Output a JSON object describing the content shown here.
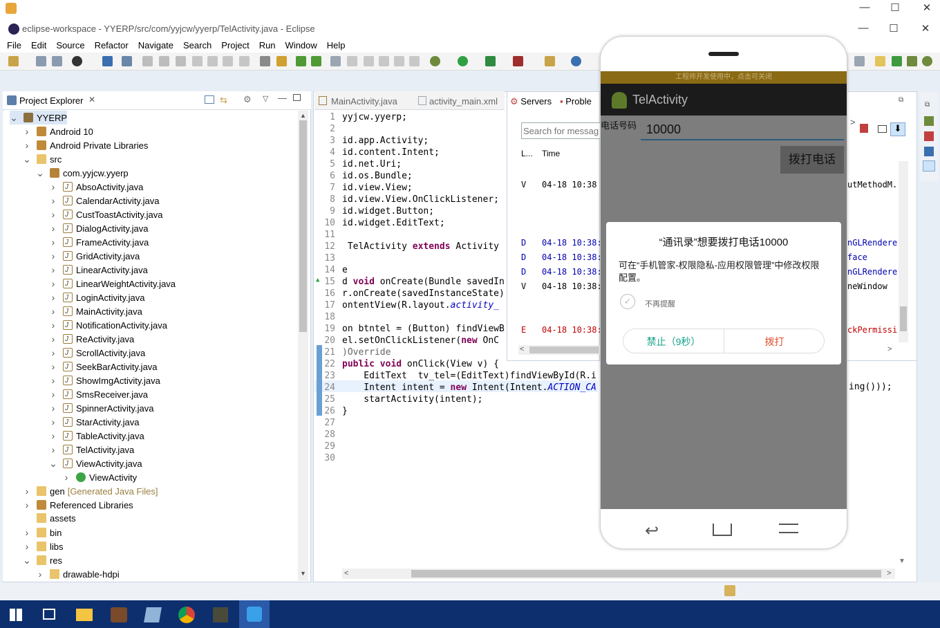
{
  "window": {
    "title": "eclipse-workspace - YYERP/src/com/yyjcw/yyerp/TelActivity.java - Eclipse"
  },
  "menu": [
    "File",
    "Edit",
    "Source",
    "Refactor",
    "Navigate",
    "Search",
    "Project",
    "Run",
    "Window",
    "Help"
  ],
  "project_explorer": {
    "tab_label": "Project Explorer",
    "items": [
      {
        "label": "YYERP",
        "level": 0,
        "twisty": "v",
        "icon": "proj"
      },
      {
        "label": "Android 10",
        "level": 1,
        "twisty": ">",
        "icon": "lib"
      },
      {
        "label": "Android Private Libraries",
        "level": 1,
        "twisty": ">",
        "icon": "lib"
      },
      {
        "label": "src",
        "level": 1,
        "twisty": "v",
        "icon": "folder"
      },
      {
        "label": "com.yyjcw.yyerp",
        "level": 2,
        "twisty": "v",
        "icon": "pkg"
      },
      {
        "label": "AbsoActivity.java",
        "level": 3,
        "twisty": ">",
        "icon": "java"
      },
      {
        "label": "CalendarActivity.java",
        "level": 3,
        "twisty": ">",
        "icon": "java"
      },
      {
        "label": "CustToastActivity.java",
        "level": 3,
        "twisty": ">",
        "icon": "java"
      },
      {
        "label": "DialogActivity.java",
        "level": 3,
        "twisty": ">",
        "icon": "java"
      },
      {
        "label": "FrameActivity.java",
        "level": 3,
        "twisty": ">",
        "icon": "java"
      },
      {
        "label": "GridActivity.java",
        "level": 3,
        "twisty": ">",
        "icon": "java"
      },
      {
        "label": "LinearActivity.java",
        "level": 3,
        "twisty": ">",
        "icon": "java"
      },
      {
        "label": "LinearWeightActivity.java",
        "level": 3,
        "twisty": ">",
        "icon": "java"
      },
      {
        "label": "LoginActivity.java",
        "level": 3,
        "twisty": ">",
        "icon": "java"
      },
      {
        "label": "MainActivity.java",
        "level": 3,
        "twisty": ">",
        "icon": "java"
      },
      {
        "label": "NotificationActivity.java",
        "level": 3,
        "twisty": ">",
        "icon": "java"
      },
      {
        "label": "ReActivity.java",
        "level": 3,
        "twisty": ">",
        "icon": "java"
      },
      {
        "label": "ScrollActivity.java",
        "level": 3,
        "twisty": ">",
        "icon": "java"
      },
      {
        "label": "SeekBarActivity.java",
        "level": 3,
        "twisty": ">",
        "icon": "java"
      },
      {
        "label": "ShowImgActivity.java",
        "level": 3,
        "twisty": ">",
        "icon": "java"
      },
      {
        "label": "SmsReceiver.java",
        "level": 3,
        "twisty": ">",
        "icon": "java"
      },
      {
        "label": "SpinnerActivity.java",
        "level": 3,
        "twisty": ">",
        "icon": "java"
      },
      {
        "label": "StarActivity.java",
        "level": 3,
        "twisty": ">",
        "icon": "java"
      },
      {
        "label": "TableActivity.java",
        "level": 3,
        "twisty": ">",
        "icon": "java"
      },
      {
        "label": "TelActivity.java",
        "level": 3,
        "twisty": ">",
        "icon": "java"
      },
      {
        "label": "ViewActivity.java",
        "level": 3,
        "twisty": "v",
        "icon": "java"
      },
      {
        "label": "ViewActivity",
        "level": 4,
        "twisty": ">",
        "icon": "class"
      },
      {
        "label": "gen",
        "level": 1,
        "twisty": ">",
        "icon": "folder",
        "suffix": "[Generated Java Files]"
      },
      {
        "label": "Referenced Libraries",
        "level": 1,
        "twisty": ">",
        "icon": "lib"
      },
      {
        "label": "assets",
        "level": 1,
        "twisty": "",
        "icon": "folder"
      },
      {
        "label": "bin",
        "level": 1,
        "twisty": ">",
        "icon": "folder"
      },
      {
        "label": "libs",
        "level": 1,
        "twisty": ">",
        "icon": "folder"
      },
      {
        "label": "res",
        "level": 1,
        "twisty": "v",
        "icon": "folder"
      },
      {
        "label": "drawable-hdpi",
        "level": 2,
        "twisty": ">",
        "icon": "folder"
      }
    ]
  },
  "editor": {
    "tabs": [
      "MainActivity.java",
      "activity_main.xml"
    ],
    "lines": [
      {
        "n": "1",
        "t": "yyjcw.yyerp;"
      },
      {
        "n": "2",
        "t": ""
      },
      {
        "n": "3",
        "t": "id.app.Activity;"
      },
      {
        "n": "4",
        "t": "id.content.Intent;"
      },
      {
        "n": "5",
        "t": "id.net.Uri;"
      },
      {
        "n": "6",
        "t": "id.os.Bundle;"
      },
      {
        "n": "7",
        "t": "id.view.View;"
      },
      {
        "n": "8",
        "t": "id.view.View.OnClickListener;"
      },
      {
        "n": "9",
        "t": "id.widget.Button;"
      },
      {
        "n": "10",
        "t": "id.widget.EditText;"
      },
      {
        "n": "11",
        "t": ""
      },
      {
        "n": "12",
        "t": " TelActivity extends Activity"
      },
      {
        "n": "13",
        "t": ""
      },
      {
        "n": "14",
        "t": "e"
      },
      {
        "n": "15",
        "t": "d void onCreate(Bundle savedIn"
      },
      {
        "n": "16",
        "t": "r.onCreate(savedInstanceState)"
      },
      {
        "n": "17",
        "t": "ontentView(R.layout.activity_"
      },
      {
        "n": "18",
        "t": ""
      },
      {
        "n": "19",
        "t": "on btntel = (Button) findViewB"
      },
      {
        "n": "20",
        "t": "el.setOnClickListener(new OnC"
      },
      {
        "n": "21",
        "t": ")Override"
      },
      {
        "n": "22",
        "t": "public void onClick(View v) {"
      },
      {
        "n": "23",
        "t": "    EditText  tv_tel=(EditText)findViewById(R.i"
      },
      {
        "n": "24",
        "t": "    Intent intent = new Intent(Intent.ACTION_CA"
      },
      {
        "n": "25",
        "t": "    startActivity(intent);"
      },
      {
        "n": "26",
        "t": "}"
      },
      {
        "n": "27",
        "t": ""
      },
      {
        "n": "28",
        "t": ""
      },
      {
        "n": "29",
        "t": ""
      },
      {
        "n": "30",
        "t": ""
      }
    ],
    "overflow_text": "ing()));"
  },
  "log_panel": {
    "tabs": [
      "Servers",
      "Proble"
    ],
    "search_placeholder": "Search for messag",
    "columns": [
      "L...",
      "Time"
    ],
    "rows": [
      {
        "level": "V",
        "time": "04-18 10:38",
        "tail": "utMethodM."
      },
      {
        "level": "D",
        "time": "04-18 10:38:",
        "tail": "nGLRendere"
      },
      {
        "level": "D",
        "time": "04-18 10:38:",
        "tail": "face"
      },
      {
        "level": "D",
        "time": "04-18 10:38:",
        "tail": "nGLRendere"
      },
      {
        "level": "V",
        "time": "04-18 10:38:",
        "tail": "neWindow"
      },
      {
        "level": "E",
        "time": "04-18 10:38:",
        "tail": "ckPermissi"
      }
    ]
  },
  "phone": {
    "banner": "工程师开发使用中，点击可关闭",
    "app_title": "TelActivity",
    "field_label": "电话号码",
    "field_value": "10000",
    "call_button": "拨打电话",
    "dialog": {
      "title": "“通讯录”想要拨打电话10000",
      "message": "可在“手机管家-权限隐私-应用权限管理”中修改权限配置。",
      "checkbox": "不再提醒",
      "deny": "禁止（9秒）",
      "allow": "拨打"
    }
  },
  "colors": {
    "taskbar": "#0d2f6e",
    "banner": "#b8860b",
    "appbar": "#1b1b1b",
    "deny": "#14a08a",
    "allow": "#e0502f"
  }
}
